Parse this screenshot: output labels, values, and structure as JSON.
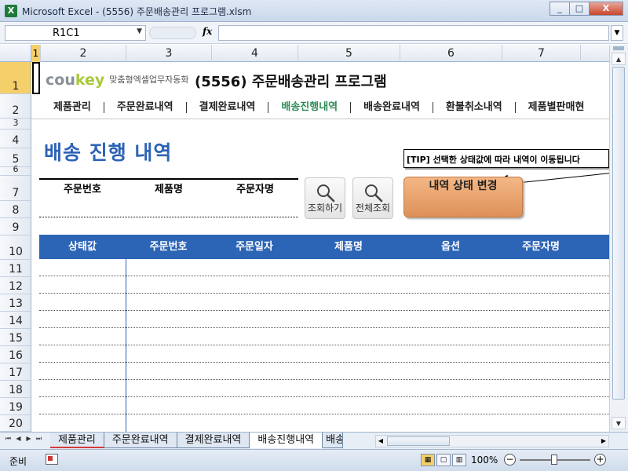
{
  "window": {
    "title": "Microsoft Excel - (5556) 주문배송관리 프로그램.xlsm",
    "app_icon": "X",
    "buttons": [
      "_",
      "□",
      "X"
    ]
  },
  "formula_bar": {
    "name_box": "R1C1",
    "fx": "fx",
    "formula": ""
  },
  "columns": [
    "1",
    "2",
    "3",
    "4",
    "5",
    "6",
    "7"
  ],
  "rows": [
    "1",
    "2",
    "3",
    "4",
    "5",
    "6",
    "7",
    "8",
    "9",
    "10",
    "11",
    "12",
    "13",
    "14",
    "15",
    "16",
    "17",
    "18",
    "19",
    "20"
  ],
  "sheet": {
    "logo_cou": "cou",
    "logo_key": "key",
    "logo_tagline": "맞춤형엑셀업무자동화",
    "app_title": "(5556) 주문배송관리 프로그램",
    "menu": [
      {
        "label": "제품관리",
        "active": false
      },
      {
        "label": "주문완료내역",
        "active": false
      },
      {
        "label": "결제완료내역",
        "active": false
      },
      {
        "label": "배송진행내역",
        "active": true
      },
      {
        "label": "배송완료내역",
        "active": false
      },
      {
        "label": "환불취소내역",
        "active": false
      },
      {
        "label": "제품별판매현",
        "active": false
      }
    ],
    "section_title": "배송 진행 내역",
    "tip": "[TIP] 선택한 상태값에 따라 내역이 이동됩니다",
    "search_fields": [
      "주문번호",
      "제품명",
      "주문자명"
    ],
    "search_button": "조회하기",
    "all_button": "전체조회",
    "status_change_button": "내역 상태 변경",
    "table_headers": [
      "상태값",
      "주문번호",
      "주문일자",
      "제품명",
      "옵션",
      "주문자명"
    ]
  },
  "sheet_tabs": [
    {
      "label": "제품관리",
      "active": false
    },
    {
      "label": "주문완료내역",
      "active": false
    },
    {
      "label": "결제완료내역",
      "active": false
    },
    {
      "label": "배송진행내역",
      "active": true
    },
    {
      "label": "배송",
      "active": false
    }
  ],
  "tab_nav": [
    "⏮",
    "◀",
    "▶",
    "⏭"
  ],
  "status_bar": {
    "ready": "준비",
    "zoom": "100%",
    "zoom_minus": "−",
    "zoom_plus": "+"
  },
  "colors": {
    "accent_blue": "#2c64b6",
    "active_menu_green": "#2e8b57",
    "status_button_orange": "#de9159",
    "logo_green": "#a9c93a"
  }
}
